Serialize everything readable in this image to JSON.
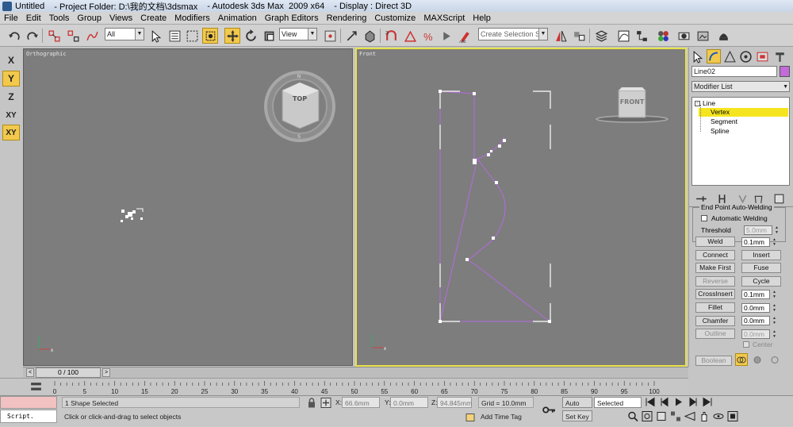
{
  "title": {
    "doc": "Untitled",
    "project": "- Project Folder: D:\\我的文档\\3dsmax",
    "app": "- Autodesk 3ds Max  2009 x64",
    "display": "- Display : Direct 3D"
  },
  "menu": [
    "File",
    "Edit",
    "Tools",
    "Group",
    "Views",
    "Create",
    "Modifiers",
    "Animation",
    "Graph Editors",
    "Rendering",
    "Customize",
    "MAXScript",
    "Help"
  ],
  "toolbar": {
    "filter_value": "All",
    "refcoord_value": "View",
    "selection_set_placeholder": "Create Selection Set"
  },
  "axis_buttons": [
    "X",
    "Y",
    "Z",
    "XY",
    "XY"
  ],
  "viewports": {
    "left_label": "Orthographic",
    "left_cube": "TOP",
    "right_label": "Front",
    "right_cube": "FRONT"
  },
  "command_panel": {
    "object_name": "Line02",
    "object_color": "#c26bd9",
    "modifier_list": "Modifier List",
    "stack": [
      "Line",
      "Vertex",
      "Segment",
      "Spline"
    ],
    "group_title": "End Point Auto-Welding",
    "auto_weld_label": "Automatic Welding",
    "threshold_label": "Threshold",
    "threshold_value": "5.0mm",
    "buttons": [
      {
        "label": "Weld",
        "value": "0.1mm",
        "enabled": true,
        "has_spin": true
      },
      {
        "label": "Connect",
        "value": "Insert",
        "enabled": true,
        "has_spin": false
      },
      {
        "label": "Make First",
        "value": "Fuse",
        "enabled": true,
        "has_spin": false
      },
      {
        "label": "Reverse",
        "value": "Cycle",
        "enabled": false,
        "has_spin": false
      },
      {
        "label": "CrossInsert",
        "value": "0.1mm",
        "enabled": true,
        "has_spin": true
      },
      {
        "label": "Fillet",
        "value": "0.0mm",
        "enabled": true,
        "has_spin": true
      },
      {
        "label": "Chamfer",
        "value": "0.0mm",
        "enabled": true,
        "has_spin": true
      },
      {
        "label": "Outline",
        "value": "0.0mm",
        "enabled": false,
        "has_spin": true
      }
    ],
    "center_label": "Center",
    "boolean_label": "Boolean"
  },
  "timeline": {
    "frame_display": "0 / 100",
    "ticks": [
      "0",
      "5",
      "10",
      "15",
      "20",
      "25",
      "30",
      "35",
      "40",
      "45",
      "50",
      "55",
      "60",
      "65",
      "70",
      "75",
      "80",
      "85",
      "90",
      "95",
      "100"
    ]
  },
  "status": {
    "selection": "1 Shape Selected",
    "prompt": "Click or click-and-drag to select objects",
    "script_label": "Script.",
    "x_label": "X:",
    "x_value": "66.6mm",
    "y_label": "Y:",
    "y_value": "0.0mm",
    "z_label": "Z:",
    "z_value": "94.845mm",
    "grid": "Grid = 10.0mm",
    "add_time_tag": "Add Time Tag",
    "auto_key": "Auto Key",
    "set_key": "Set Key",
    "key_filter": "Selected"
  },
  "colors": {
    "viewport_bg": "#7d7d7d",
    "active_border": "#e8e24a",
    "spline": "#b46be0",
    "highlight": "#f2c94c"
  }
}
